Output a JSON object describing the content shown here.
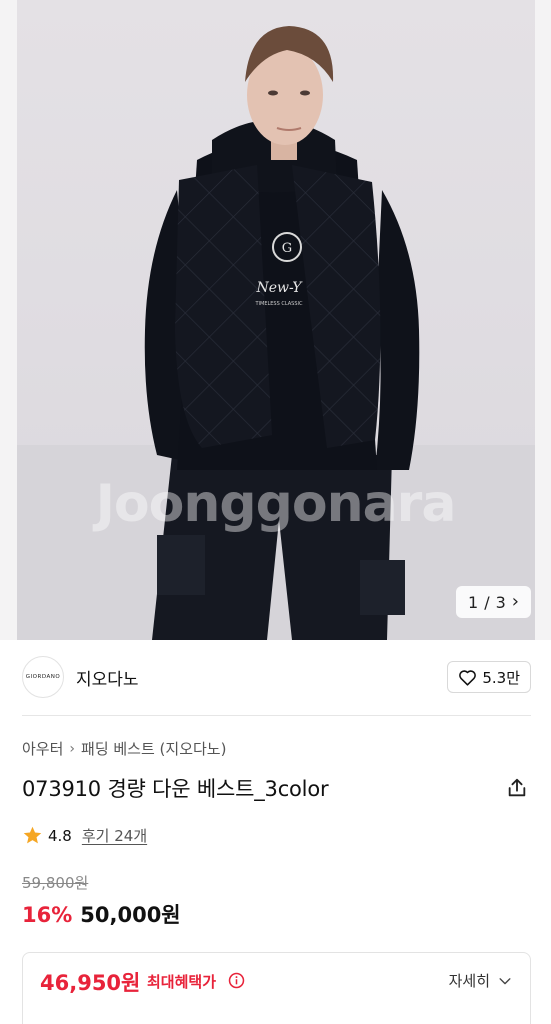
{
  "gallery": {
    "watermark": "Joonggonara",
    "current": "1",
    "total": "3",
    "separator": "/"
  },
  "brand": {
    "logo_text": "GIORDANO",
    "name": "지오다노",
    "like_count": "5.3만"
  },
  "breadcrumb": {
    "category": "아우터",
    "subcategory": "패딩 베스트 (지오다노)"
  },
  "product": {
    "title": "073910 경량 다운 베스트_3color",
    "rating": "4.8",
    "review_link": "후기 24개"
  },
  "price": {
    "original": "59,800원",
    "discount": "16%",
    "sale": "50,000원"
  },
  "benefit": {
    "max_price": "46,950원",
    "label": "최대혜택가",
    "detail_label": "자세히"
  },
  "colors": {
    "accent_red": "#e8233a",
    "star": "#f5a623"
  }
}
